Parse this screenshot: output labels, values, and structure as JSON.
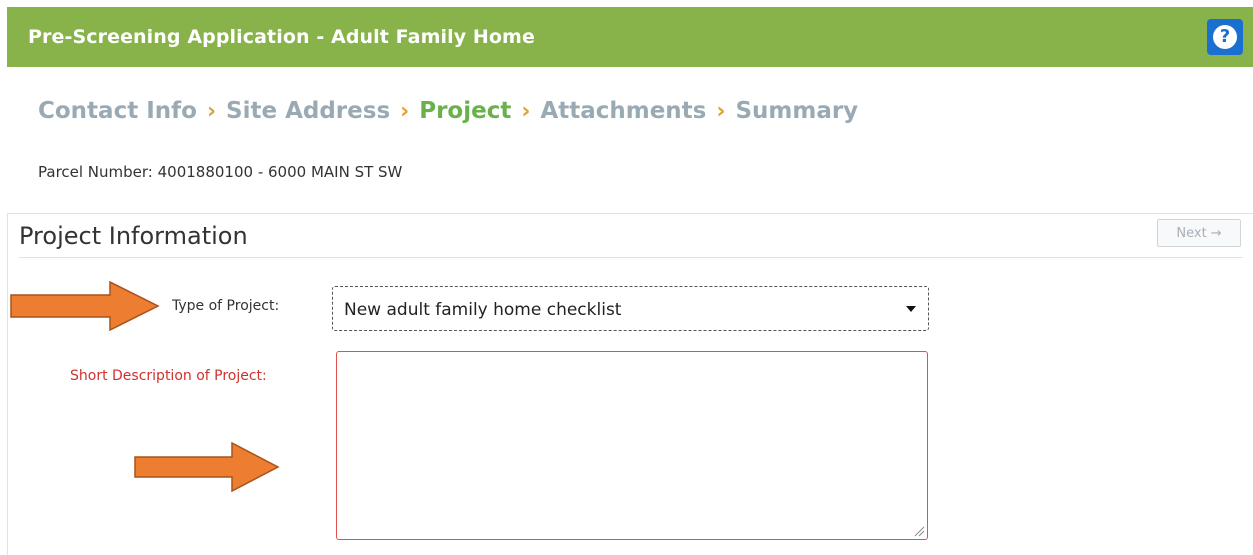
{
  "header": {
    "title": "Pre-Screening Application - Adult Family Home",
    "help_symbol": "?",
    "bg_color": "#88b34a"
  },
  "breadcrumb": {
    "items": [
      {
        "label": "Contact Info",
        "active": false
      },
      {
        "label": "Site Address",
        "active": false
      },
      {
        "label": "Project",
        "active": true
      },
      {
        "label": "Attachments",
        "active": false
      },
      {
        "label": "Summary",
        "active": false
      }
    ],
    "separator": "›",
    "active_color": "#6ab04c",
    "inactive_color": "#9aaab4",
    "separator_color": "#e0a030"
  },
  "parcel": {
    "text": "Parcel Number: 4001880100 - 6000 MAIN ST SW"
  },
  "panel": {
    "title": "Project Information",
    "next_label": "Next",
    "next_icon": "→"
  },
  "form": {
    "type_label": "Type of Project:",
    "type_value": "New adult family home checklist",
    "description_label": "Short Description of Project:",
    "description_value": ""
  },
  "annotations": {
    "arrow_color": "#ed7d31"
  }
}
